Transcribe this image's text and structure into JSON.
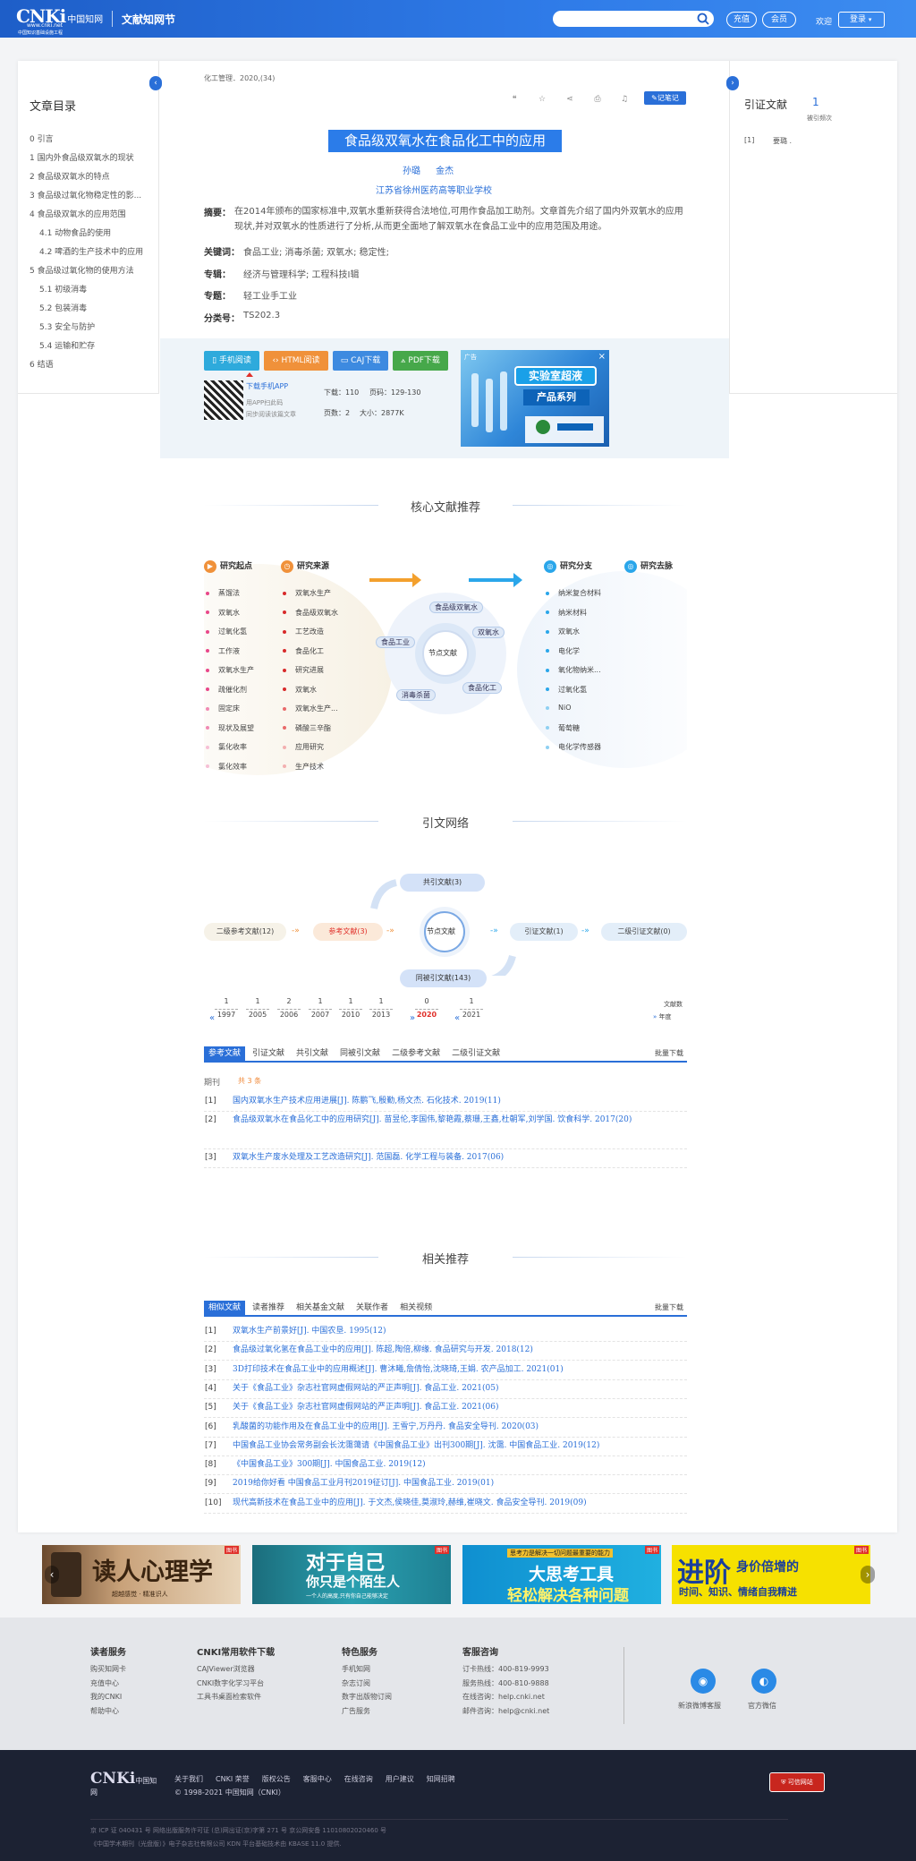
{
  "header": {
    "logo_text": "CNKi",
    "logo_cn": "中国知网",
    "logo_url": "www.cnki.net",
    "logo_slogan": "中国知识基础设施工程",
    "title": "文献知网节",
    "search_placeholder": "",
    "btn_recharge": "充值",
    "btn_member": "会员",
    "welcome": "欢迎",
    "login": "登录"
  },
  "toc": {
    "title": "文章目录",
    "items": [
      "0 引言",
      "1 国内外食品级双氧水的现状",
      "2 食品级双氧水的特点",
      "3 食品级过氧化物稳定性的影...",
      "4 食品级双氧水的应用范围",
      "4.1 动物食品的使用",
      "4.2 啤酒的生产技术中的应用",
      "5 食品级过氧化物的使用方法",
      "5.1 初级消毒",
      "5.2 包装消毒",
      "5.3 安全与防护",
      "5.4 运输和贮存",
      "6 结语"
    ]
  },
  "right": {
    "title": "引证文献",
    "count": "1",
    "count_label": "被引频次",
    "items": [
      {
        "n": "[1]",
        "t": "要璐 ."
      }
    ]
  },
  "article": {
    "source": "化工管理．2020,(34)",
    "note_btn": "记笔记",
    "title": "食品级双氧水在食品化工中的应用",
    "authors": "孙璐 金杰",
    "org": "江苏省徐州医药高等职业学校",
    "abstract_label": "摘要：",
    "abstract": "在2014年颁布的国家标准中,双氧水重新获得合法地位,可用作食品加工助剂。文章首先介绍了国内外双氧水的应用现状,并对双氧水的性质进行了分析,从而更全面地了解双氧水在食品工业中的应用范围及用途。",
    "kw_label": "关键词：",
    "keywords": "食品工业;  消毒杀菌;  双氧水;  稳定性;",
    "series_label": "专辑：",
    "series": "经济与管理科学; 工程科技Ⅰ辑",
    "topic_label": "专题：",
    "topic": "轻工业手工业",
    "cls_label": "分类号：",
    "cls": "TS202.3"
  },
  "download": {
    "btn_phone": "手机阅读",
    "btn_html": "HTML阅读",
    "btn_caj": "CAJ下载",
    "btn_pdf": "PDF下载",
    "app_link": "下载手机APP",
    "app_desc1": "用APP扫此码",
    "app_desc2": "同步阅读该篇文章",
    "downloads_label": "下载：",
    "downloads": "110",
    "pages_label": "页码：",
    "pages": "129-130",
    "pagecount_label": "页数：",
    "pagecount": "2",
    "size_label": "大小：",
    "size": "2877K",
    "ad_label": "广告",
    "ad_title1": "实验室超液",
    "ad_title2": "产品系列",
    "ad_close": "×"
  },
  "core": {
    "title": "核心文献推荐",
    "col1": "研究起点",
    "col2": "研究来源",
    "col3": "研究分支",
    "col4": "研究去脉",
    "list1": [
      "蒸馏法",
      "双氧水",
      "过氧化氢",
      "工作液",
      "双氧水生产",
      "疏催化剂",
      "固定床",
      "现状及展望",
      "氯化收率",
      "氯化效率"
    ],
    "list2": [
      "双氧水生产",
      "食品级双氧水",
      "工艺改造",
      "食品化工",
      "研究进展",
      "双氧水",
      "双氧水生产...",
      "磷酸三辛酯",
      "应用研究",
      "生产技术"
    ],
    "list3": [
      "纳米复合材料",
      "纳米材料",
      "双氧水",
      "电化学",
      "氧化物纳米...",
      "过氧化氢",
      "NiO",
      "葡萄糖",
      "电化学传感器"
    ],
    "center": "节点文献",
    "tags": [
      "食品级双氧水",
      "食品工业",
      "双氧水",
      "消毒杀菌",
      "食品化工"
    ]
  },
  "network": {
    "title": "引文网络",
    "second_ref": "二级参考文献(12)",
    "ref": "参考文献(3)",
    "center": "节点文献",
    "cite": "引证文献(1)",
    "second_cite": "二级引证文献(0)",
    "co_ref": "共引文献(3)",
    "co_cited": "同被引文献(143)",
    "years": [
      {
        "c": "1",
        "y": "1997"
      },
      {
        "c": "1",
        "y": "2005"
      },
      {
        "c": "2",
        "y": "2006"
      },
      {
        "c": "1",
        "y": "2007"
      },
      {
        "c": "1",
        "y": "2010"
      },
      {
        "c": "1",
        "y": "2013"
      },
      {
        "c": "0",
        "y": "2020"
      },
      {
        "c": "1",
        "y": "2021"
      }
    ],
    "legend_count": "文献数",
    "legend_year": "年度"
  },
  "reftabs": {
    "tabs": [
      "参考文献",
      "引证文献",
      "共引文献",
      "同被引文献",
      "二级参考文献",
      "二级引证文献"
    ],
    "batch": "批量下载",
    "kind": "期刊",
    "total": "共 3 条",
    "items": [
      {
        "n": "[1]",
        "t": "国内双氧水生产技术应用进展[J]. 陈鹏飞,殷勤,杨文杰.  石化技术. 2019(11)"
      },
      {
        "n": "[2]",
        "t": "食品级双氧水在食品化工中的应用研究[J]. 苗昱伦,李国伟,黎艳霞,蔡珊,王鑫,杜朝军,刘学国.  饮食科学. 2017(20)"
      },
      {
        "n": "[3]",
        "t": "双氧水生产废水处理及工艺改造研究[J]. 范国磊.  化学工程与装备. 2017(06)"
      }
    ]
  },
  "related": {
    "title": "相关推荐",
    "tabs": [
      "相似文献",
      "读者推荐",
      "相关基金文献",
      "关联作者",
      "相关视频"
    ],
    "batch": "批量下载",
    "items": [
      {
        "n": "[1]",
        "t": "双氧水生产前景好[J].   中国农垦. 1995(12)"
      },
      {
        "n": "[2]",
        "t": "食品级过氧化氢在食品工业中的应用[J]. 陈超,陶倍,柳缘.  食品研究与开发. 2018(12)"
      },
      {
        "n": "[3]",
        "t": "3D打印技术在食品工业中的应用概述[J]. 曹沐曦,詹倩怡,沈晓琦,王娟.  农产品加工. 2021(01)"
      },
      {
        "n": "[4]",
        "t": "关于《食品工业》杂志社官网虚假网站的严正声明[J].   食品工业. 2021(05)"
      },
      {
        "n": "[5]",
        "t": "关于《食品工业》杂志社官网虚假网站的严正声明[J].   食品工业. 2021(06)"
      },
      {
        "n": "[6]",
        "t": "乳酸菌的功能作用及在食品工业中的应用[J]. 王雪宁,万丹丹.  食品安全导刊. 2020(03)"
      },
      {
        "n": "[7]",
        "t": "中国食品工业协会常务副会长沈霭蔼请《中国食品工业》出刊300期[J]. 沈霭.  中国食品工业. 2019(12)"
      },
      {
        "n": "[8]",
        "t": "《中国食品工业》300期[J].   中国食品工业. 2019(12)"
      },
      {
        "n": "[9]",
        "t": "2019给你好看 中国食品工业月刊2019征订[J].   中国食品工业. 2019(01)"
      },
      {
        "n": "[10]",
        "t": "现代高新技术在食品工业中的应用[J]. 于文杰,侯晓佳,莫淑玲,赫维,崔晓文.  食品安全导刊. 2019(09)"
      }
    ]
  },
  "banners": [
    {
      "text": "读人心理学",
      "sub": "超越感觉 · 精准识人",
      "badge": "图书"
    },
    {
      "text": "对于自己",
      "text2": "你只是个陌生人",
      "sub": "一个人的高度,只有你自己能够决定",
      "badge": "图书"
    },
    {
      "text": "大思考工具",
      "text2": "轻松解决各种问题",
      "top": "思考力是解决一切问题最重要的能力",
      "badge": "图书"
    },
    {
      "text": "进阶",
      "text2": "身价倍增的",
      "sub": "时间、知识、情绪自我精进",
      "badge": "图书"
    }
  ],
  "footer": {
    "c1": {
      "title": "读者服务",
      "links": [
        "购买知网卡",
        "充值中心",
        "我的CNKI",
        "帮助中心"
      ]
    },
    "c2": {
      "title": "CNKI常用软件下载",
      "links": [
        "CAJViewer浏览器",
        "CNKI数字化学习平台",
        "工具书桌面检索软件"
      ]
    },
    "c3": {
      "title": "特色服务",
      "links": [
        "手机知网",
        "杂志订阅",
        "数字出版物订阅",
        "广告服务"
      ]
    },
    "c4": {
      "title": "客服咨询",
      "links": [
        "订卡热线：400-819-9993",
        "服务热线：400-810-9888",
        "在线咨询：help.cnki.net",
        "邮件咨询：help@cnki.net"
      ]
    },
    "weibo": "新浪微博客服",
    "wechat": "官方微信",
    "bottom_links": [
      "关于我们",
      "CNKI 荣誉",
      "版权公告",
      "客服中心",
      "在线咨询",
      "用户建议",
      "知网招聘"
    ],
    "copyright": "© 1998-2021 中国知网（CNKI）",
    "icp1": "京 ICP 证 040431 号  网络出版服务许可证 (总)网出证(京)字第 271 号  京公网安备 11010802020460 号",
    "icp2": "《中国学术期刊（光盘版）》电子杂志社有限公司 KDN 平台基础技术由 KBASE 11.0 提供.",
    "badge": "可信网站"
  }
}
